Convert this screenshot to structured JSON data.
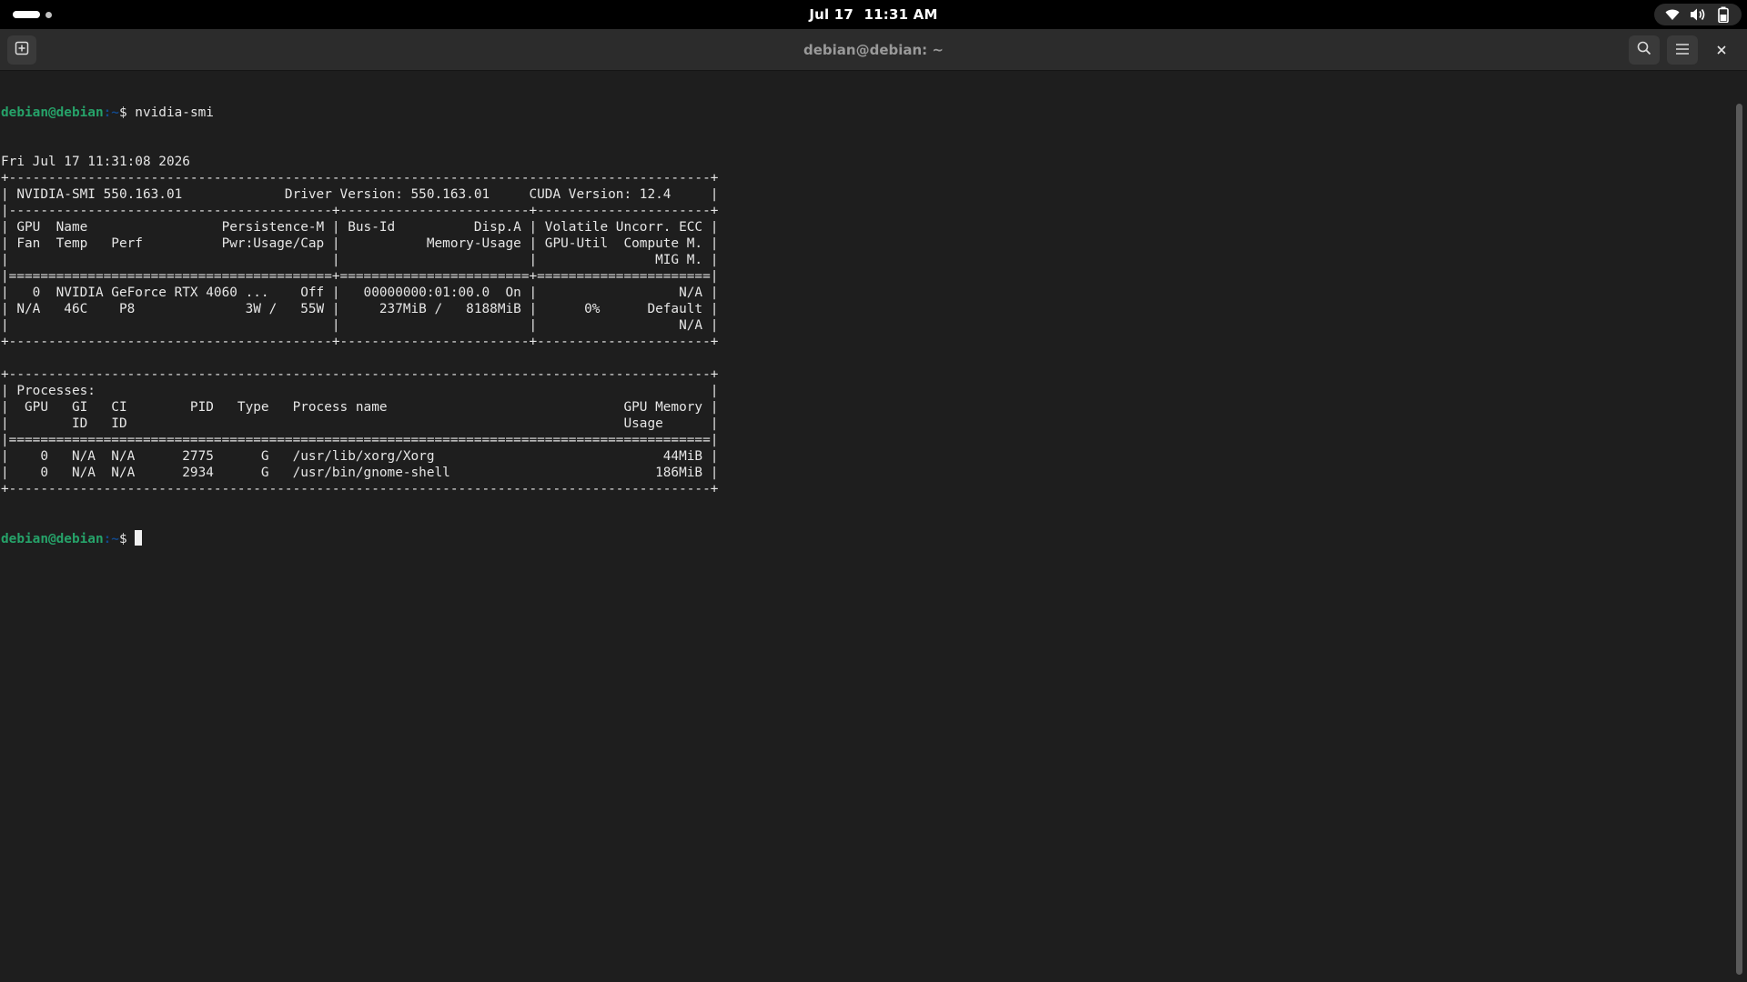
{
  "topbar": {
    "date": "Jul 17",
    "time": "11:31 AM",
    "icons": [
      "wifi-icon",
      "volume-icon",
      "battery-icon"
    ]
  },
  "window": {
    "title": "debian@debian: ~",
    "buttons": [
      "new-tab-icon",
      "search-icon",
      "hamburger-menu-icon",
      "close-icon"
    ]
  },
  "terminal": {
    "prompt_user": "debian@debian",
    "prompt_path": ":~",
    "prompt_symbol": "$ ",
    "command": "nvidia-smi",
    "output": [
      "Fri Jul 17 11:31:08 2026",
      "+-----------------------------------------------------------------------------------------+",
      "| NVIDIA-SMI 550.163.01             Driver Version: 550.163.01     CUDA Version: 12.4     |",
      "|-----------------------------------------+------------------------+----------------------+",
      "| GPU  Name                 Persistence-M | Bus-Id          Disp.A | Volatile Uncorr. ECC |",
      "| Fan  Temp   Perf          Pwr:Usage/Cap |           Memory-Usage | GPU-Util  Compute M. |",
      "|                                         |                        |               MIG M. |",
      "|=========================================+========================+======================|",
      "|   0  NVIDIA GeForce RTX 4060 ...    Off |   00000000:01:00.0  On |                  N/A |",
      "| N/A   46C    P8              3W /   55W |     237MiB /   8188MiB |      0%      Default |",
      "|                                         |                        |                  N/A |",
      "+-----------------------------------------+------------------------+----------------------+",
      "",
      "+-----------------------------------------------------------------------------------------+",
      "| Processes:                                                                              |",
      "|  GPU   GI   CI        PID   Type   Process name                              GPU Memory |",
      "|        ID   ID                                                               Usage      |",
      "|=========================================================================================|",
      "|    0   N/A  N/A      2775      G   /usr/lib/xorg/Xorg                             44MiB |",
      "|    0   N/A  N/A      2934      G   /usr/bin/gnome-shell                          186MiB |",
      "+-----------------------------------------------------------------------------------------+"
    ]
  },
  "colors": {
    "prompt_user": "#26a269",
    "prompt_path": "#12488b",
    "background": "#1e1e1e",
    "foreground": "#e6e6e6"
  }
}
